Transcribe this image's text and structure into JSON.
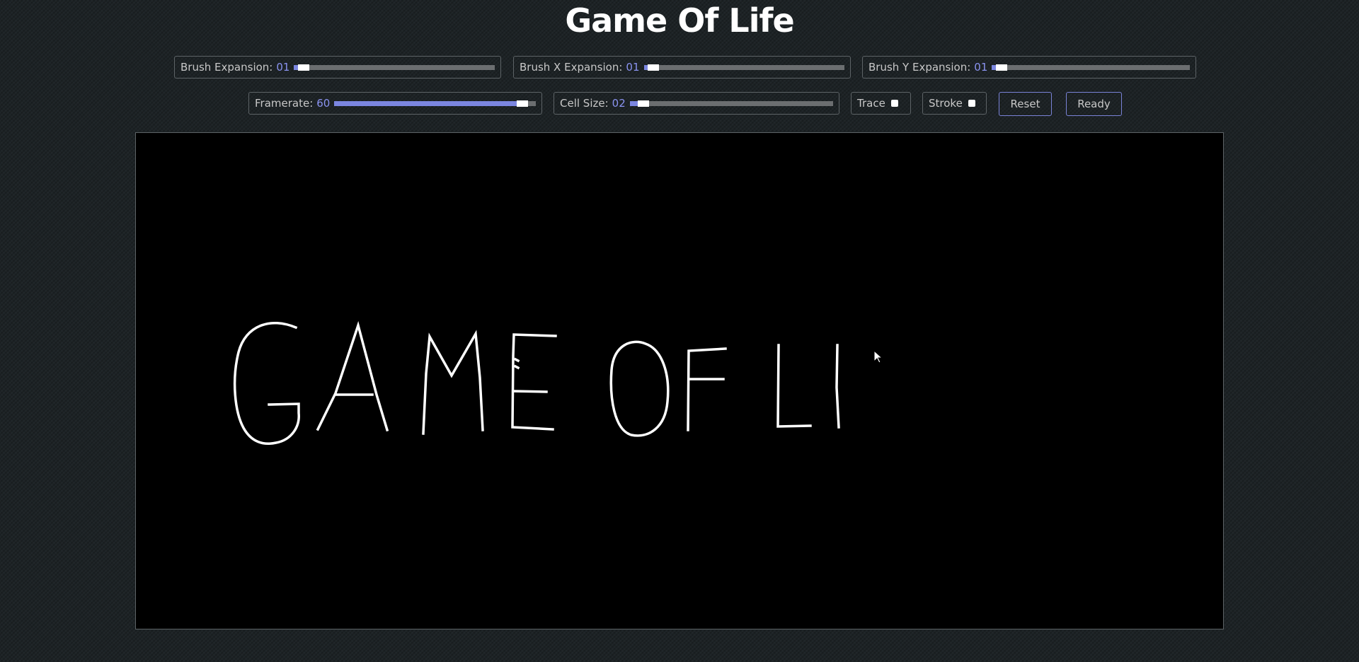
{
  "app": {
    "title": "Game Of Life"
  },
  "controls": {
    "brush_expansion": {
      "label": "Brush Expansion:",
      "value": "01",
      "level": 0.02
    },
    "brush_x_expansion": {
      "label": "Brush X Expansion:",
      "value": "01",
      "level": 0.02
    },
    "brush_y_expansion": {
      "label": "Brush Y Expansion:",
      "value": "01",
      "level": 0.02
    },
    "framerate": {
      "label": "Framerate:",
      "value": "60",
      "level": 0.96
    },
    "cell_size": {
      "label": "Cell Size:",
      "value": "02",
      "level": 0.04
    },
    "trace": {
      "label": "Trace",
      "checked": false
    },
    "stroke": {
      "label": "Stroke",
      "checked": false
    }
  },
  "buttons": {
    "reset": "Reset",
    "ready": "Ready"
  },
  "colors": {
    "accent": "#7b86e0",
    "background": "#1d2326",
    "canvas": "#000000",
    "cells": "#ffffff"
  },
  "canvas": {
    "drawing_text": "GAME OF LI"
  }
}
